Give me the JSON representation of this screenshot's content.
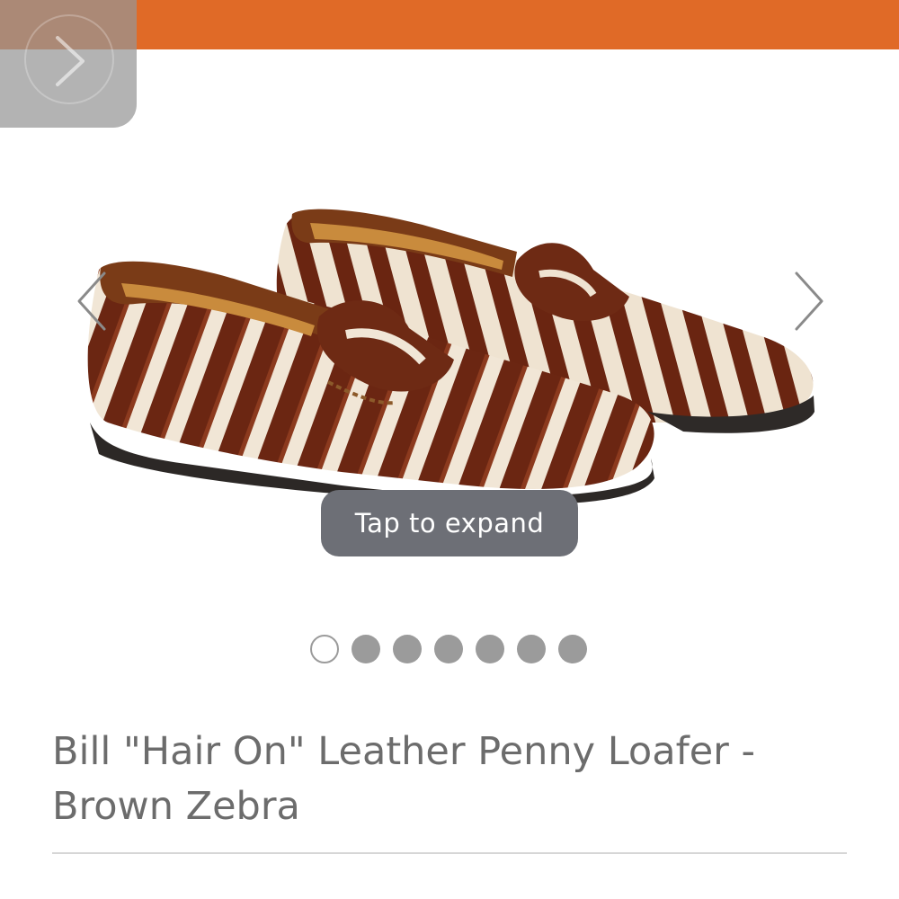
{
  "banner": {
    "color": "#e06a27"
  },
  "product": {
    "title": "Bill \"Hair On\" Leather Penny Loafer - Brown Zebra",
    "image": "zebra-print-penny-loafers"
  },
  "gallery": {
    "tap_label": "Tap to expand",
    "prev_icon": "chevron-left-icon",
    "next_icon": "chevron-right-icon",
    "current_index": 1,
    "total": 7
  },
  "expand_control": {
    "icon": "chevron-right-icon"
  }
}
